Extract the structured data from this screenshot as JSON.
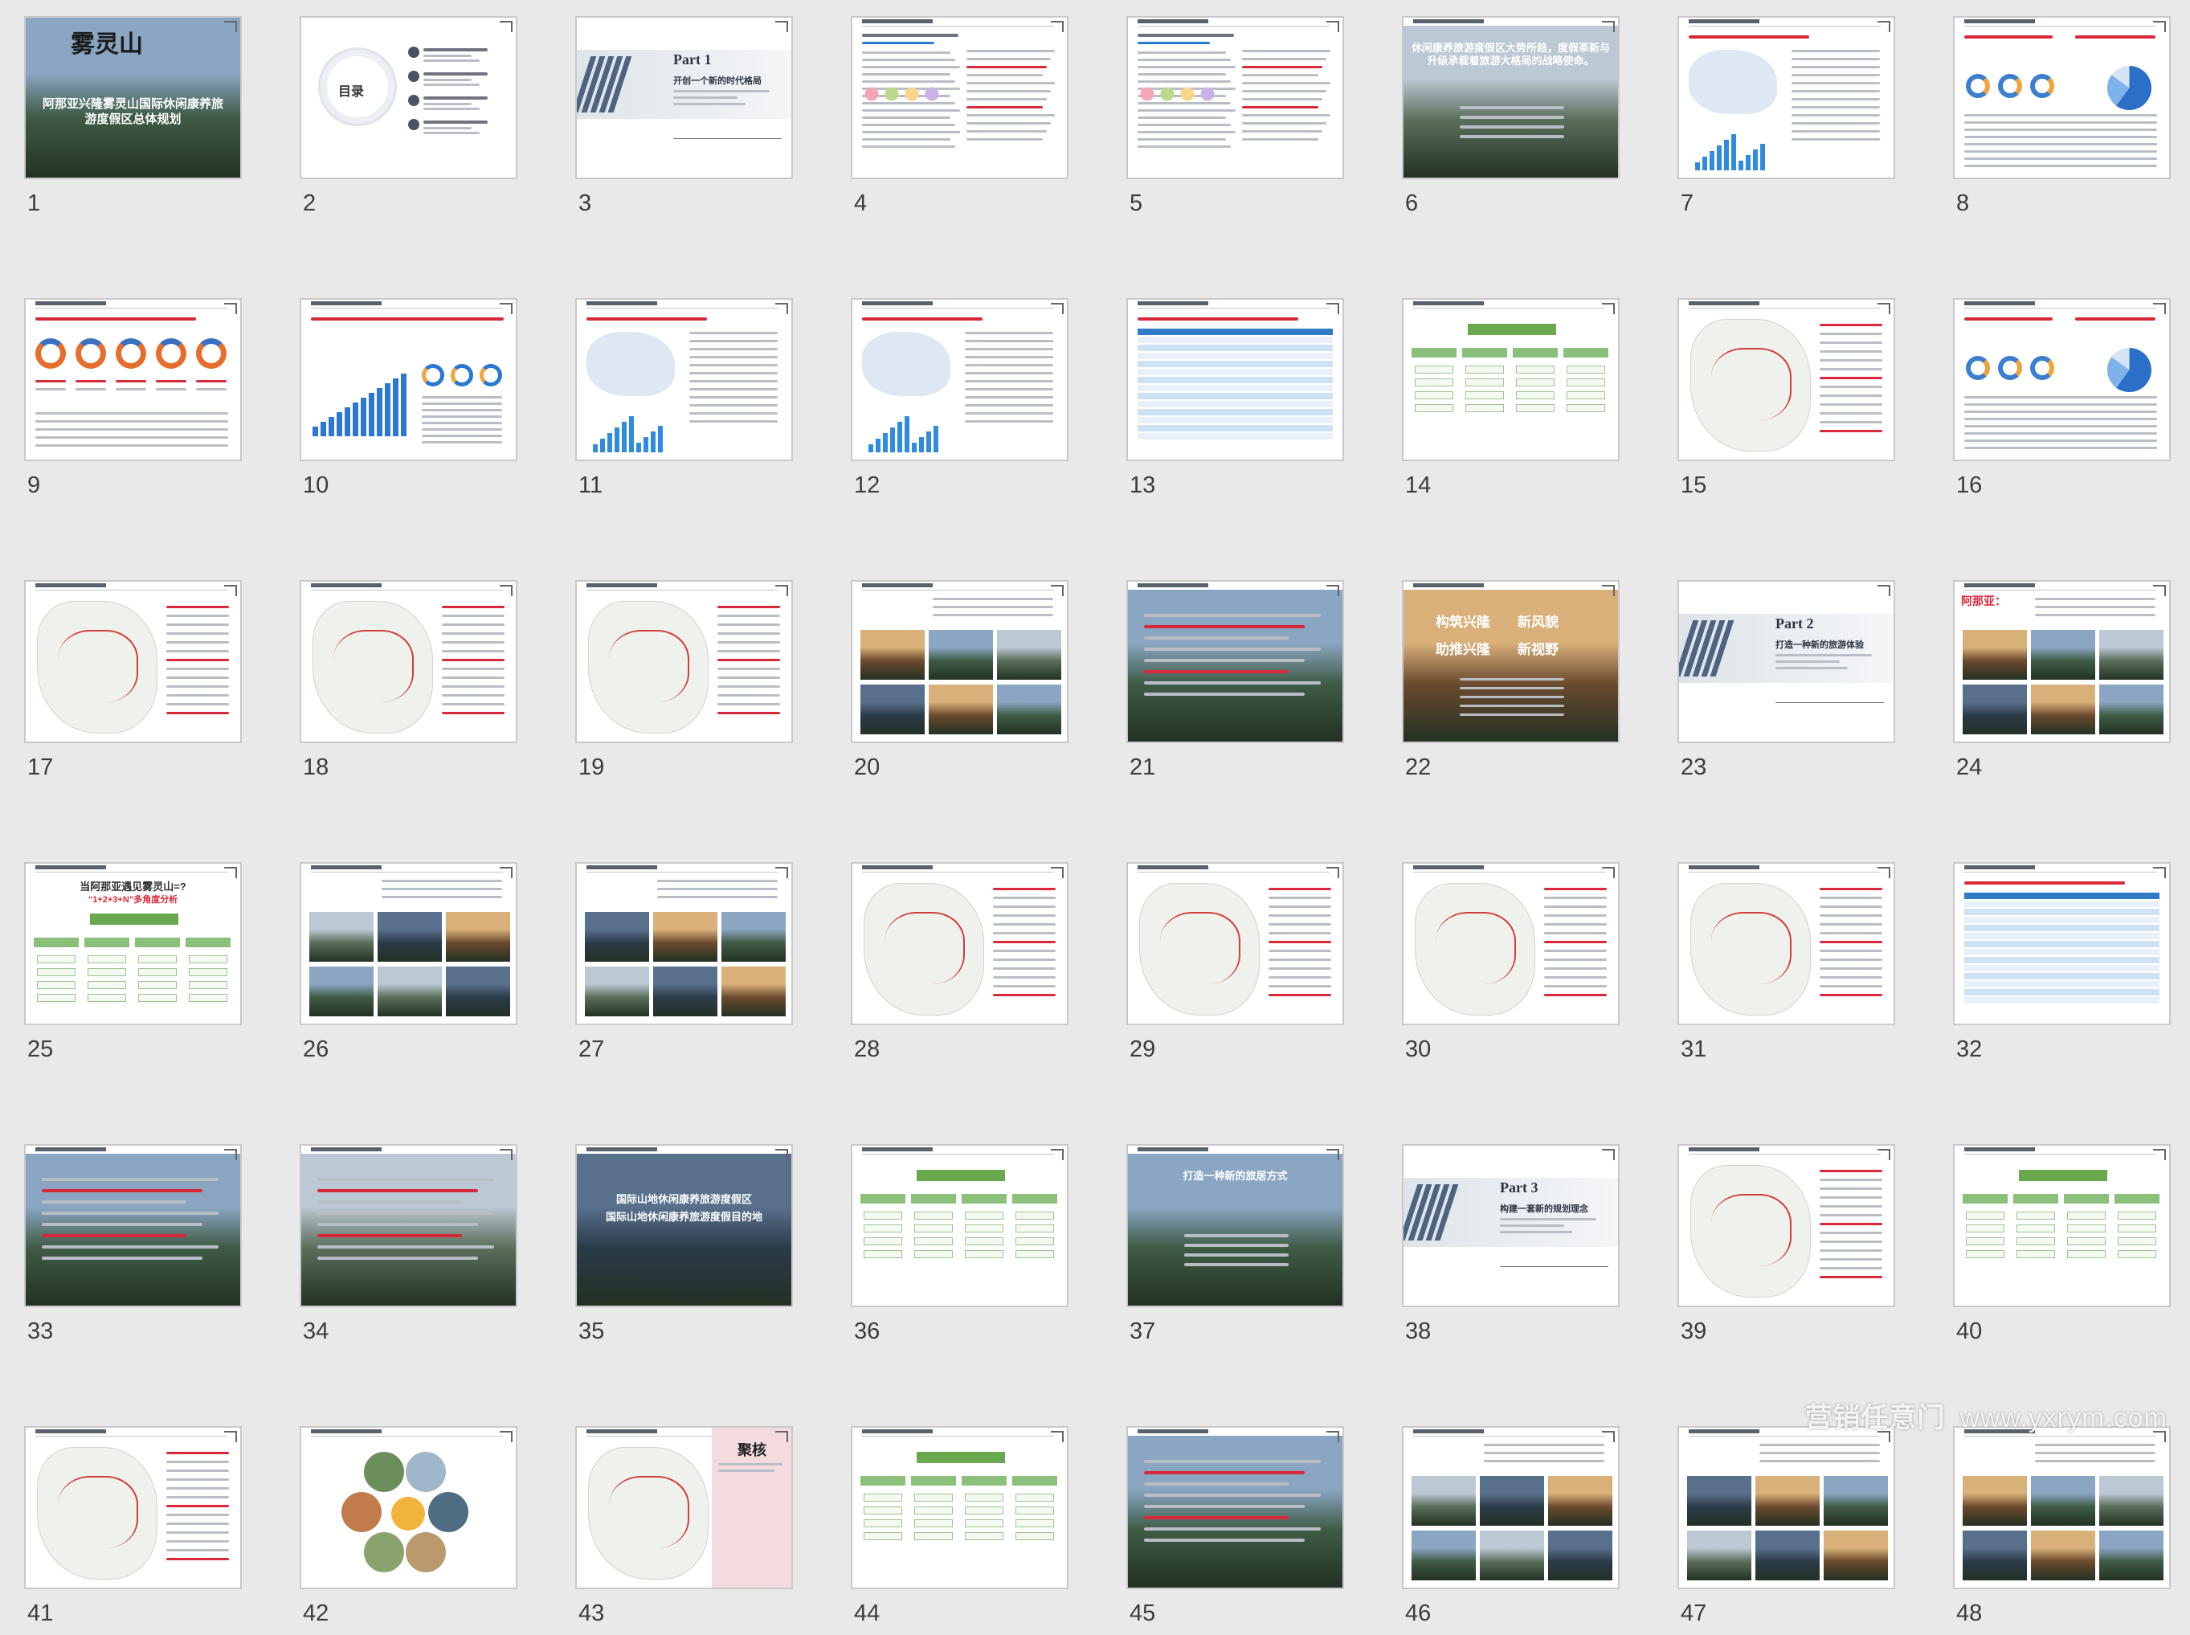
{
  "slides": [
    {
      "n": "1",
      "kind": "cover",
      "title": "阿那亚兴隆雾灵山国际休闲康养旅游度假区总体规划",
      "logo": "雾灵山"
    },
    {
      "n": "2",
      "kind": "toc",
      "title": "目录"
    },
    {
      "n": "3",
      "kind": "part",
      "part": "Part 1",
      "title": "开创一个新的时代格局"
    },
    {
      "n": "4",
      "kind": "text"
    },
    {
      "n": "5",
      "kind": "text"
    },
    {
      "n": "6",
      "kind": "photo-text",
      "headline": "休闲康养旅游度假区大势所趋，度假革新与升级承载着旅游大格局的战略使命。"
    },
    {
      "n": "7",
      "kind": "chart-map"
    },
    {
      "n": "8",
      "kind": "chart-mix"
    },
    {
      "n": "9",
      "kind": "rings"
    },
    {
      "n": "10",
      "kind": "bars"
    },
    {
      "n": "11",
      "kind": "chart-map"
    },
    {
      "n": "12",
      "kind": "chart-map"
    },
    {
      "n": "13",
      "kind": "table"
    },
    {
      "n": "14",
      "kind": "diagram"
    },
    {
      "n": "15",
      "kind": "map"
    },
    {
      "n": "16",
      "kind": "chart-mix"
    },
    {
      "n": "17",
      "kind": "map"
    },
    {
      "n": "18",
      "kind": "map"
    },
    {
      "n": "19",
      "kind": "map"
    },
    {
      "n": "20",
      "kind": "photo-grid"
    },
    {
      "n": "21",
      "kind": "photo-text"
    },
    {
      "n": "22",
      "kind": "headline-photo",
      "lines": [
        "构筑兴隆",
        "新风貌",
        "助推兴隆",
        "新视野"
      ]
    },
    {
      "n": "23",
      "kind": "part",
      "part": "Part 2",
      "title": "打造一种新的旅游体验"
    },
    {
      "n": "24",
      "kind": "photo-grid",
      "headline": "阿那亚："
    },
    {
      "n": "25",
      "kind": "diagram",
      "headline": "当阿那亚遇见雾灵山=?",
      "sub": "“1+2+3+N”多角度分析"
    },
    {
      "n": "26",
      "kind": "photo-grid"
    },
    {
      "n": "27",
      "kind": "photo-grid"
    },
    {
      "n": "28",
      "kind": "map"
    },
    {
      "n": "29",
      "kind": "map"
    },
    {
      "n": "30",
      "kind": "map"
    },
    {
      "n": "31",
      "kind": "map"
    },
    {
      "n": "32",
      "kind": "table"
    },
    {
      "n": "33",
      "kind": "photo-text"
    },
    {
      "n": "34",
      "kind": "photo-text"
    },
    {
      "n": "35",
      "kind": "photo-text",
      "lines": [
        "国际山地休闲康养旅游度假区",
        "国际山地休闲康养旅游度假目的地"
      ]
    },
    {
      "n": "36",
      "kind": "diagram"
    },
    {
      "n": "37",
      "kind": "photo-text",
      "headline": "打造一种新的旅居方式"
    },
    {
      "n": "38",
      "kind": "part",
      "part": "Part 3",
      "title": "构建一套新的规划理念"
    },
    {
      "n": "39",
      "kind": "map"
    },
    {
      "n": "40",
      "kind": "diagram"
    },
    {
      "n": "41",
      "kind": "map"
    },
    {
      "n": "42",
      "kind": "circles"
    },
    {
      "n": "43",
      "kind": "map",
      "headline": "聚核"
    },
    {
      "n": "44",
      "kind": "diagram"
    },
    {
      "n": "45",
      "kind": "photo-text"
    },
    {
      "n": "46",
      "kind": "photo-grid"
    },
    {
      "n": "47",
      "kind": "photo-grid"
    },
    {
      "n": "48",
      "kind": "photo-grid"
    }
  ],
  "watermark": {
    "cn": "营销任意门",
    "url": "www.yxrym.com"
  }
}
